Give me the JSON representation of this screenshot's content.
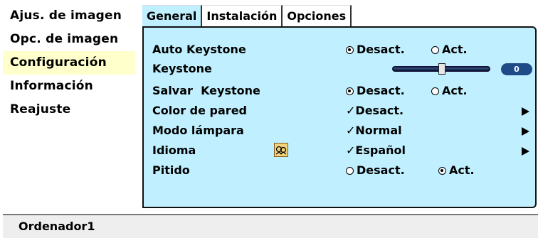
{
  "nav": {
    "items": [
      {
        "label": "Ajus. de imagen",
        "active": false
      },
      {
        "label": "Opc. de imagen",
        "active": false
      },
      {
        "label": "Configuración",
        "active": true
      },
      {
        "label": "Información",
        "active": false
      },
      {
        "label": "Reajuste",
        "active": false
      }
    ]
  },
  "tabs": [
    {
      "label": "General",
      "active": true
    },
    {
      "label": "Instalación",
      "active": false
    },
    {
      "label": "Opciones",
      "active": false
    }
  ],
  "settings": {
    "auto_keystone": {
      "label": "Auto Keystone",
      "opt1": "Desact.",
      "opt2": "Act.",
      "selected": "opt1"
    },
    "keystone": {
      "label": "Keystone",
      "value": "0",
      "slider_level": 0.5
    },
    "salvar_keystone": {
      "label": "Salvar  Keystone",
      "opt1": "Desact.",
      "opt2": "Act.",
      "selected": "opt1"
    },
    "color_pared": {
      "label": "Color de pared",
      "value": "Desact."
    },
    "modo_lampara": {
      "label": "Modo lámpara",
      "value": "Normal"
    },
    "idioma": {
      "label": "Idioma",
      "value": "Español",
      "icon": "language-icon"
    },
    "pitido": {
      "label": "Pitido",
      "opt1": "Desact.",
      "opt2": "Act.",
      "selected": "opt2"
    }
  },
  "status": {
    "source": "Ordenador1"
  },
  "colors": {
    "panel_bg": "#c0f0ff",
    "nav_active_bg": "#ffffcc",
    "value_pill_bg": "#1e4a88"
  }
}
